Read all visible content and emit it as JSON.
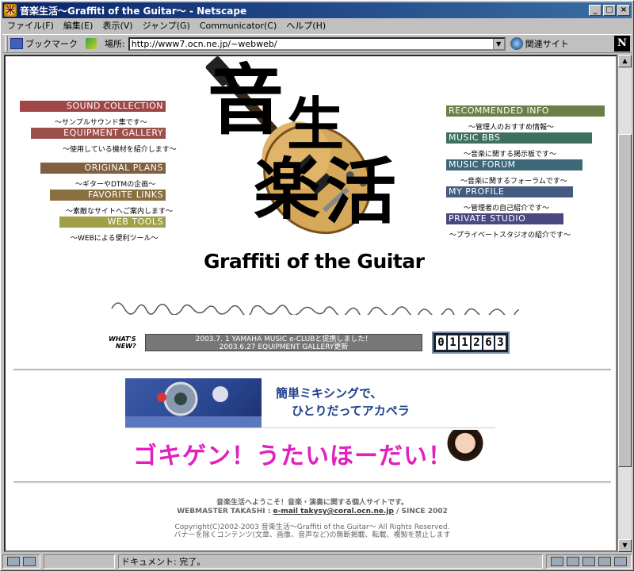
{
  "window": {
    "title": "音楽生活〜Graffiti of the Guitar〜 - Netscape",
    "title_icon_glyph": "米",
    "min_glyph": "_",
    "max_glyph": "□",
    "close_glyph": "×"
  },
  "menu": [
    "ファイル(F)",
    "編集(E)",
    "表示(V)",
    "ジャンプ(G)",
    "Communicator(C)",
    "ヘルプ(H)"
  ],
  "toolbar": {
    "bookmarks_label": "ブックマーク",
    "location_label": "場所:",
    "url": "http://www7.ocn.ne.jp/~webweb/",
    "dropdown_glyph": "▼",
    "related_label": "関連サイト",
    "netscape_logo": "N"
  },
  "page": {
    "logo_chars": [
      "音",
      "生",
      "楽",
      "活"
    ],
    "logo_subtitle": "Graffiti of the Guitar",
    "left_nav": [
      {
        "label": "SOUND COLLECTION",
        "desc": "〜サンプルサウンド集です〜",
        "color": "#a04848"
      },
      {
        "label": "EQUIPMENT GALLERY",
        "desc": "〜使用している機材を紹介します〜",
        "color": "#9a5048"
      },
      {
        "label": "ORIGINAL PLANS",
        "desc": "〜ギターやDTMの企画〜",
        "color": "#806040"
      },
      {
        "label": "FAVORITE LINKS",
        "desc": "〜素敵なサイトへご案内します〜",
        "color": "#8a7040"
      },
      {
        "label": "WEB TOOLS",
        "desc": "〜WEBによる便利ツール〜",
        "color": "#a0a048"
      }
    ],
    "right_nav": [
      {
        "label": "RECOMMENDED INFO",
        "desc": "〜管理人のおすすめ情報〜",
        "color": "#6a8048"
      },
      {
        "label": "MUSIC BBS",
        "desc": "〜音楽に関する掲示板です〜",
        "color": "#3e7060"
      },
      {
        "label": "MUSIC FORUM",
        "desc": "〜音楽に関するフォーラムです〜",
        "color": "#3e6878"
      },
      {
        "label": "MY PROFILE",
        "desc": "〜管理者の自己紹介です〜",
        "color": "#445a80"
      },
      {
        "label": "PRIVATE STUDIO",
        "desc": "〜プライベートスタジオの紹介です〜",
        "color": "#4a4880"
      }
    ],
    "whats_new_label_1": "WHAT'S",
    "whats_new_label_2": "NEW?",
    "news_1": "2003.7. 1 YAMAHA MUSIC e-CLUBと提携しました！",
    "news_2": "2003.6.27 EQUIPMENT GALLERY更新",
    "counter_digits": [
      "0",
      "1",
      "1",
      "2",
      "6",
      "3"
    ],
    "banner1_line1": "簡単ミキシングで、",
    "banner1_line2": "ひとりだってアカペラ",
    "banner2_text": "ゴキゲン！うたいほーだい！",
    "footer_welcome": "音楽生活へようこそ！音楽・演奏に関する個人サイトです。",
    "footer_webmaster_prefix": "WEBMASTER TAKASHI :",
    "footer_email": "e-mail takysy@coral.ocn.ne.jp",
    "footer_since": "/ SINCE 2002",
    "footer_copyright": "Copyright(C)2002-2003 音楽生活〜Graffiti of the Guitar〜 All Rights Reserved.",
    "footer_notice": "バナーを除くコンテンツ(文章、画像、音声など)の無断掲載、転載、複製を禁止します"
  },
  "status": {
    "text": "ドキュメント: 完了。"
  }
}
